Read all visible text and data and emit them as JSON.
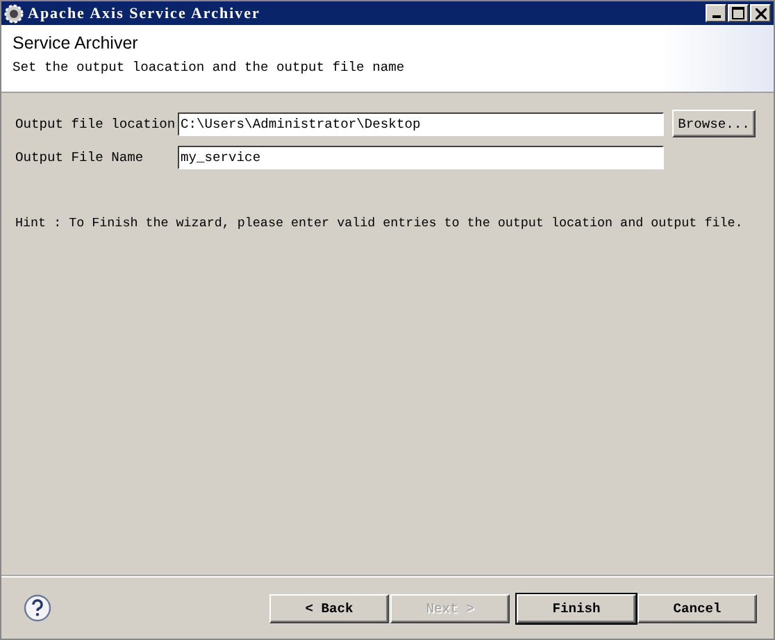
{
  "window": {
    "title": "Apache Axis Service Archiver"
  },
  "header": {
    "title": "Service Archiver",
    "description": "Set the output loacation and the output file name"
  },
  "fields": [
    {
      "label": "Output file location",
      "value": "C:\\Users\\Administrator\\Desktop",
      "button": "Browse..."
    },
    {
      "label": "Output File Name",
      "value": "my_service"
    }
  ],
  "hint": "Hint : To Finish the wizard, please enter valid entries to the output location and output file.",
  "buttons": [
    {
      "label": "< Back",
      "disabled": false,
      "default": false
    },
    {
      "label": "Next >",
      "disabled": true,
      "default": false
    },
    {
      "label": "Finish",
      "disabled": false,
      "default": true
    },
    {
      "label": "Cancel",
      "disabled": false,
      "default": false
    }
  ]
}
